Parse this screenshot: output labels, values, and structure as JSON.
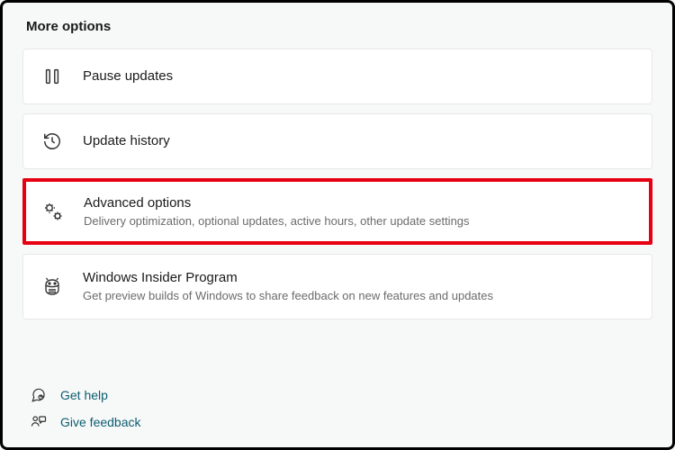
{
  "section_title": "More options",
  "options": {
    "pause": {
      "label": "Pause updates"
    },
    "history": {
      "label": "Update history"
    },
    "advanced": {
      "label": "Advanced options",
      "desc": "Delivery optimization, optional updates, active hours, other update settings"
    },
    "insider": {
      "label": "Windows Insider Program",
      "desc": "Get preview builds of Windows to share feedback on new features and updates"
    }
  },
  "footer": {
    "help": "Get help",
    "feedback": "Give feedback"
  }
}
